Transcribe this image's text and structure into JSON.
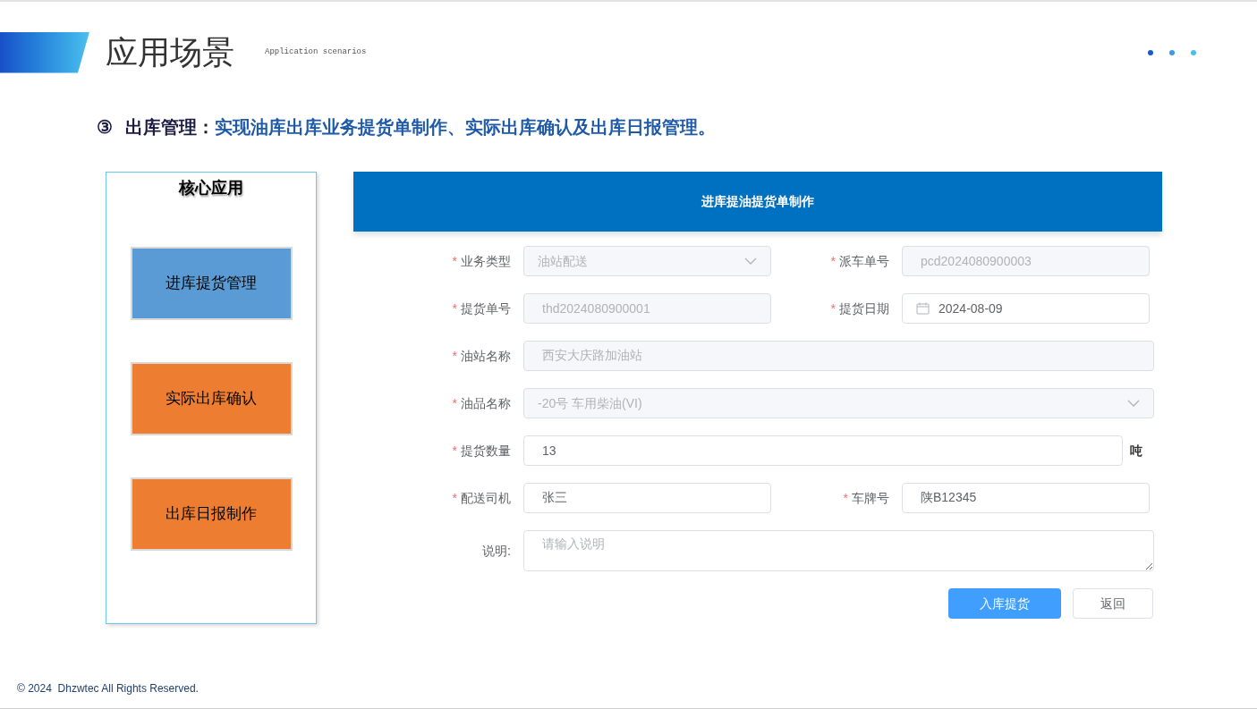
{
  "header": {
    "title": "应用场景",
    "subtitle": "Application scenarios"
  },
  "heading": {
    "number": "③",
    "title": "出库管理：",
    "description": "实现油库出库业务提货单制作、实际出库确认及出库日报管理。"
  },
  "core_panel": {
    "title": "核心应用",
    "items": [
      {
        "label": "进库提货管理",
        "color": "#5b9bd5"
      },
      {
        "label": "实际出库确认",
        "color": "#ed7d31"
      },
      {
        "label": "出库日报制作",
        "color": "#ed7d31"
      }
    ]
  },
  "form": {
    "title": "进库提油提货单制作",
    "rows": [
      {
        "fields": [
          {
            "label": "业务类型",
            "required_mark": "*",
            "kind": "select",
            "value": "油站配送",
            "disabled": true
          },
          {
            "label": "派车单号",
            "required_mark": "*",
            "kind": "text",
            "value": "pcd2024080900003",
            "disabled": true
          }
        ]
      },
      {
        "fields": [
          {
            "label": "提货单号",
            "required_mark": "*",
            "kind": "text",
            "value": "thd2024080900001",
            "disabled": true
          },
          {
            "label": "提货日期",
            "required_mark": "*",
            "kind": "date",
            "value": "2024-08-09",
            "disabled": false
          }
        ]
      },
      {
        "fields": [
          {
            "label": "油站名称",
            "required_mark": "*",
            "kind": "text",
            "value": "西安大庆路加油站",
            "disabled": true
          }
        ]
      },
      {
        "fields": [
          {
            "label": "油品名称",
            "required_mark": "*",
            "kind": "select",
            "value": "-20号 车用柴油(VI)",
            "disabled": true
          }
        ]
      },
      {
        "fields": [
          {
            "label": "提货数量",
            "required_mark": "*",
            "kind": "text",
            "value": "13",
            "unit": "吨",
            "disabled": false
          }
        ]
      },
      {
        "fields": [
          {
            "label": "配送司机",
            "required_mark": "*",
            "kind": "text",
            "value": "张三",
            "disabled": false
          },
          {
            "label": "车牌号",
            "required_mark": "*",
            "kind": "text",
            "value": "陕B12345",
            "disabled": false
          }
        ]
      },
      {
        "fields": [
          {
            "label": "说明:",
            "kind": "textarea",
            "placeholder": "请输入说明"
          }
        ]
      }
    ],
    "buttons": [
      {
        "label": "入库提货",
        "kind": "primary"
      },
      {
        "label": "返回",
        "kind": "default"
      }
    ]
  },
  "footer": "© 2024  Dhzwtec All Rights Reserved."
}
